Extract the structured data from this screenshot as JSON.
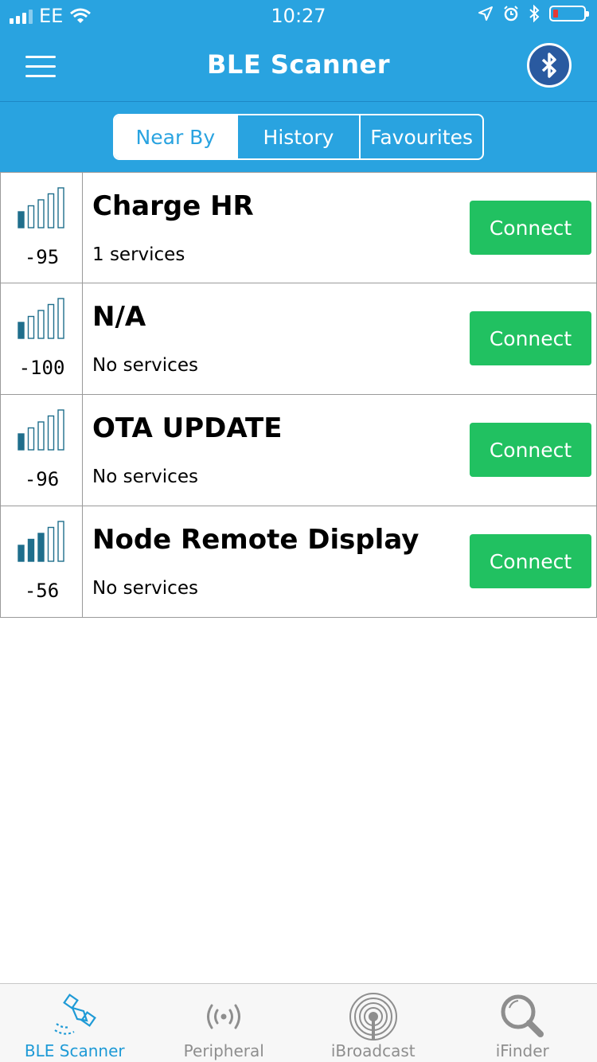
{
  "status_bar": {
    "carrier": "EE",
    "time": "10:27",
    "icons": [
      "signal-icon",
      "wifi-icon",
      "location-icon",
      "alarm-icon",
      "bluetooth-icon",
      "battery-low-icon"
    ]
  },
  "nav": {
    "title": "BLE Scanner",
    "left_icon": "menu-icon",
    "right_icon": "bluetooth-icon"
  },
  "segments": {
    "items": [
      "Near By",
      "History",
      "Favourites"
    ],
    "selected": "Near By"
  },
  "devices": [
    {
      "name": "Charge HR",
      "rssi": "-95",
      "services": "1 services",
      "signal_bars_filled": 1,
      "action": "Connect"
    },
    {
      "name": "N/A",
      "rssi": "-100",
      "services": "No services",
      "signal_bars_filled": 1,
      "action": "Connect"
    },
    {
      "name": "OTA UPDATE",
      "rssi": "-96",
      "services": "No services",
      "signal_bars_filled": 1,
      "action": "Connect"
    },
    {
      "name": "Node Remote Display",
      "rssi": "-56",
      "services": "No services",
      "signal_bars_filled": 3,
      "action": "Connect"
    }
  ],
  "tab_bar": {
    "items": [
      {
        "label": "BLE Scanner",
        "icon": "ble-scanner-icon",
        "active": true
      },
      {
        "label": "Peripheral",
        "icon": "peripheral-icon",
        "active": false
      },
      {
        "label": "iBroadcast",
        "icon": "broadcast-icon",
        "active": false
      },
      {
        "label": "iFinder",
        "icon": "magnifier-icon",
        "active": false
      }
    ]
  },
  "colors": {
    "header": "#29a3e0",
    "connect": "#21c161",
    "signal": "#1f6e8c",
    "tab_active": "#1e9ad6"
  }
}
